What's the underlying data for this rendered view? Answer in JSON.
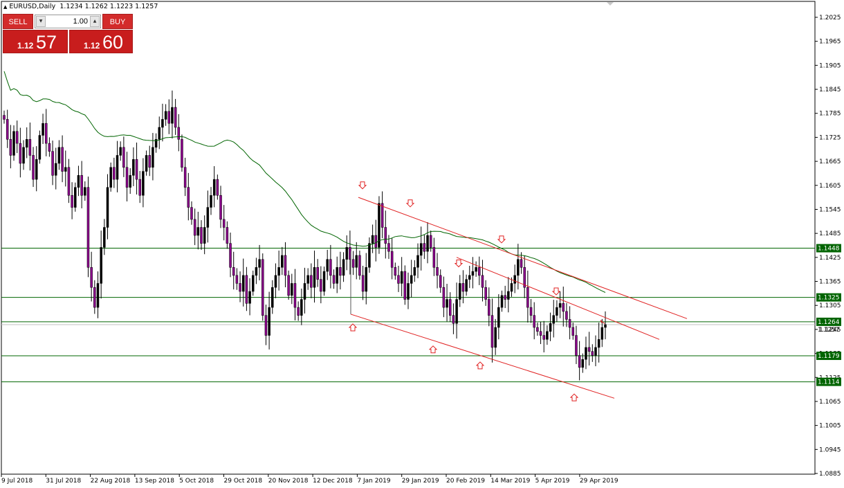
{
  "header": {
    "symbol": "EURUSD,Daily",
    "ohlc": "1.1234 1.1262 1.1223 1.1257"
  },
  "trade_panel": {
    "sell_label": "SELL",
    "buy_label": "BUY",
    "lot": "1.00",
    "sell_price_prefix": "1.12",
    "sell_price_pips": "57",
    "buy_price_prefix": "1.12",
    "buy_price_pips": "60"
  },
  "colors": {
    "bull": "#000000",
    "bear": "#8b008b",
    "ma": "#006400",
    "trendline": "#e02020",
    "level": "#006400",
    "level_label_bg": "#006400",
    "arrow": "#e02020",
    "panel": "#d32b2b"
  },
  "chart_data": {
    "type": "candlestick",
    "symbol": "EURUSD",
    "timeframe": "Daily",
    "ylim": [
      1.0885,
      1.2055
    ],
    "y_ticks": [
      "1.2025",
      "1.1965",
      "1.1905",
      "1.1845",
      "1.1785",
      "1.1725",
      "1.1665",
      "1.1605",
      "1.1545",
      "1.1485",
      "1.1425",
      "1.1365",
      "1.1305",
      "1.1245",
      "1.1185",
      "1.1125",
      "1.1065",
      "1.1005",
      "1.0945",
      "1.0885"
    ],
    "x_ticks": [
      "9 Jul 2018",
      "31 Jul 2018",
      "22 Aug 2018",
      "13 Sep 2018",
      "5 Oct 2018",
      "29 Oct 2018",
      "20 Nov 2018",
      "12 Dec 2018",
      "7 Jan 2019",
      "29 Jan 2019",
      "20 Feb 2019",
      "14 Mar 2019",
      "5 Apr 2019",
      "29 Apr 2019"
    ],
    "levels": [
      {
        "label": "1.1448",
        "value": 1.1448
      },
      {
        "label": "1.1325",
        "value": 1.1325
      },
      {
        "label": "1.1264",
        "value": 1.1264
      },
      {
        "label": "1.1179",
        "value": 1.1179
      },
      {
        "label": "1.1114",
        "value": 1.1114
      }
    ],
    "bid_line": {
      "label": "1.1257",
      "value": 1.1257
    },
    "closes": [
      1.177,
      1.172,
      1.168,
      1.174,
      1.171,
      1.166,
      1.17,
      1.172,
      1.168,
      1.162,
      1.167,
      1.173,
      1.176,
      1.171,
      1.169,
      1.163,
      1.166,
      1.17,
      1.164,
      1.165,
      1.158,
      1.155,
      1.16,
      1.163,
      1.158,
      1.16,
      1.14,
      1.135,
      1.13,
      1.136,
      1.145,
      1.15,
      1.16,
      1.165,
      1.162,
      1.168,
      1.17,
      1.165,
      1.16,
      1.163,
      1.167,
      1.162,
      1.158,
      1.164,
      1.168,
      1.165,
      1.17,
      1.172,
      1.175,
      1.177,
      1.179,
      1.176,
      1.18,
      1.175,
      1.172,
      1.165,
      1.16,
      1.155,
      1.152,
      1.148,
      1.15,
      1.146,
      1.15,
      1.155,
      1.158,
      1.162,
      1.158,
      1.152,
      1.15,
      1.146,
      1.14,
      1.138,
      1.136,
      1.134,
      1.138,
      1.131,
      1.134,
      1.138,
      1.14,
      1.142,
      1.128,
      1.123,
      1.13,
      1.135,
      1.138,
      1.14,
      1.143,
      1.138,
      1.133,
      1.136,
      1.13,
      1.128,
      1.132,
      1.136,
      1.138,
      1.135,
      1.14,
      1.137,
      1.134,
      1.139,
      1.142,
      1.138,
      1.136,
      1.14,
      1.138,
      1.142,
      1.145,
      1.142,
      1.14,
      1.143,
      1.138,
      1.134,
      1.14,
      1.146,
      1.148,
      1.145,
      1.156,
      1.15,
      1.146,
      1.144,
      1.14,
      1.138,
      1.136,
      1.139,
      1.132,
      1.136,
      1.138,
      1.14,
      1.143,
      1.146,
      1.144,
      1.148,
      1.145,
      1.14,
      1.138,
      1.135,
      1.13,
      1.132,
      1.128,
      1.126,
      1.132,
      1.136,
      1.134,
      1.137,
      1.138,
      1.139,
      1.14,
      1.138,
      1.135,
      1.132,
      1.128,
      1.12,
      1.125,
      1.13,
      1.133,
      1.132,
      1.134,
      1.136,
      1.138,
      1.142,
      1.14,
      1.135,
      1.13,
      1.128,
      1.125,
      1.124,
      1.123,
      1.122,
      1.124,
      1.126,
      1.128,
      1.13,
      1.131,
      1.129,
      1.127,
      1.125,
      1.123,
      1.118,
      1.115,
      1.117,
      1.12,
      1.119,
      1.118,
      1.12,
      1.122,
      1.125,
      1.1257
    ]
  }
}
